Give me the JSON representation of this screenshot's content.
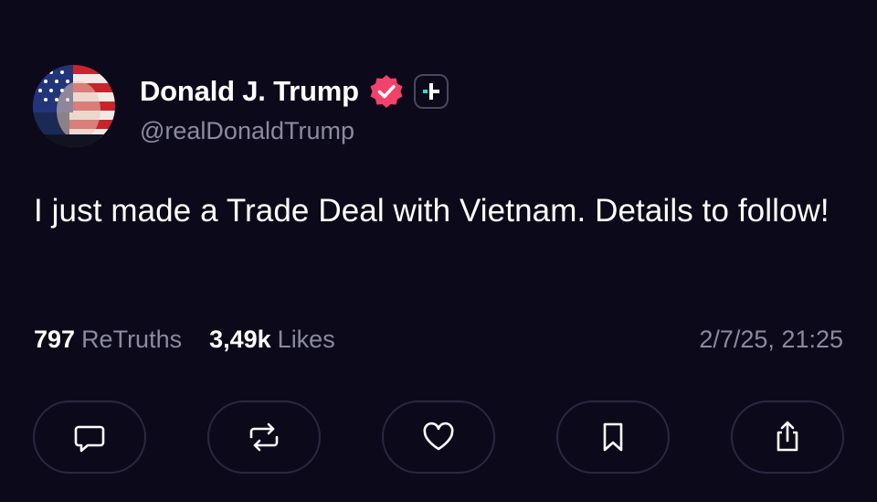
{
  "post": {
    "author": {
      "display_name": "Donald J. Trump",
      "handle": "@realDonaldTrump",
      "verified": true,
      "verified_badge_color": "#f2426b"
    },
    "text": "I just made a Trade Deal with Vietnam. Details to follow!",
    "stats": {
      "retruths_count": "797",
      "retruths_label": "ReTruths",
      "likes_count": "3,49k",
      "likes_label": "Likes"
    },
    "timestamp": "2/7/25, 21:25"
  },
  "actions": [
    {
      "icon": "reply-icon"
    },
    {
      "icon": "retruth-icon"
    },
    {
      "icon": "heart-icon"
    },
    {
      "icon": "bookmark-icon"
    },
    {
      "icon": "share-icon"
    }
  ],
  "colors": {
    "background": "#0c0a1a",
    "text_primary": "#ffffff",
    "text_secondary": "#8b8a9e",
    "button_border": "#2a2840",
    "accent_teal": "#3ad6c7"
  }
}
